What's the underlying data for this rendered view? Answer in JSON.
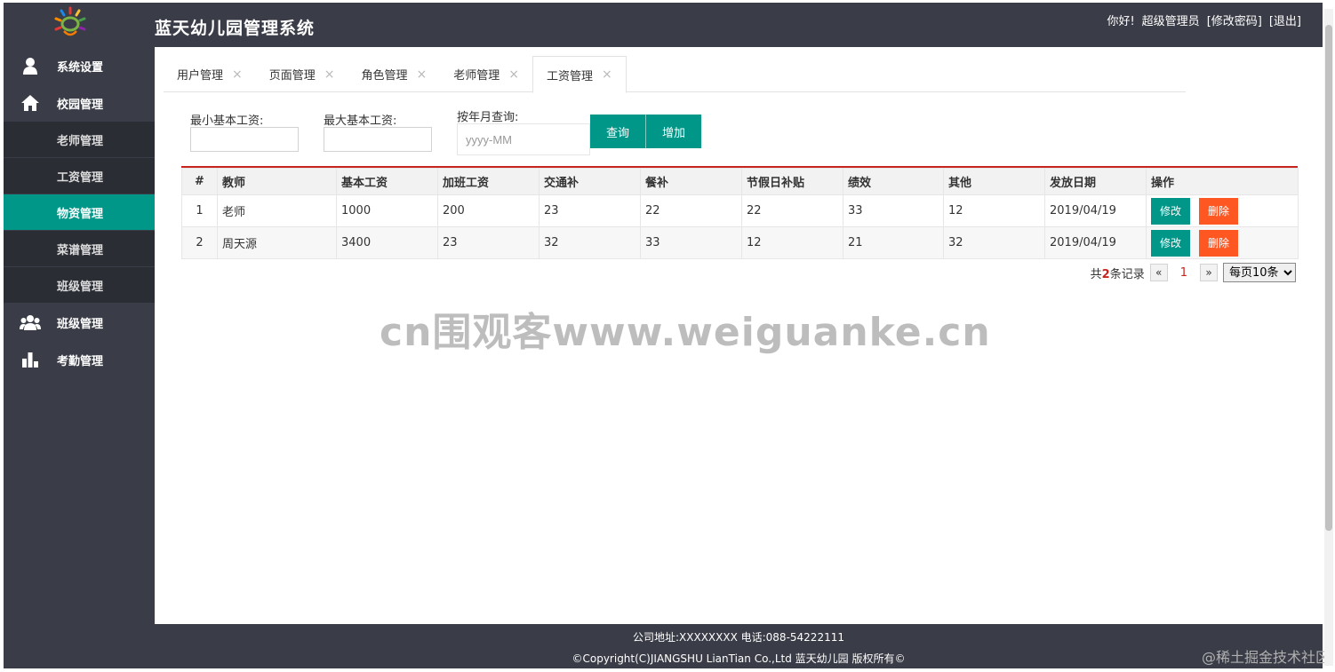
{
  "header": {
    "app_title": "蓝天幼儿园管理系统",
    "greeting": "你好!",
    "username": "超级管理员",
    "change_password": "[修改密码]",
    "logout": "[退出]"
  },
  "sidebar": {
    "items": [
      {
        "label": "系统设置",
        "icon": "user-icon"
      },
      {
        "label": "校园管理",
        "icon": "home-icon"
      },
      {
        "label": "班级管理",
        "icon": "group-icon"
      },
      {
        "label": "考勤管理",
        "icon": "bar-chart-icon"
      }
    ],
    "sub_items": [
      {
        "label": "老师管理"
      },
      {
        "label": "工资管理"
      },
      {
        "label": "物资管理"
      },
      {
        "label": "菜谱管理"
      },
      {
        "label": "班级管理"
      }
    ],
    "active_sub": "物资管理"
  },
  "tabs": [
    {
      "label": "用户管理",
      "close": "×"
    },
    {
      "label": "页面管理",
      "close": "×"
    },
    {
      "label": "角色管理",
      "close": "×"
    },
    {
      "label": "老师管理",
      "close": "×"
    },
    {
      "label": "工资管理",
      "close": "×"
    }
  ],
  "filters": {
    "min_salary_label": "最小基本工资:",
    "min_salary_value": "",
    "max_salary_label": "最大基本工资:",
    "max_salary_value": "",
    "month_label": "按年月查询:",
    "month_placeholder": "yyyy-MM",
    "query_button": "查询",
    "add_button": "增加"
  },
  "table": {
    "headers": [
      "#",
      "教师",
      "基本工资",
      "加班工资",
      "交通补",
      "餐补",
      "节假日补贴",
      "绩效",
      "其他",
      "发放日期",
      "操作"
    ],
    "rows": [
      {
        "no": "1",
        "teacher": "老师",
        "base": "1000",
        "overtime": "200",
        "traffic": "23",
        "meal": "22",
        "holiday": "22",
        "performance": "33",
        "other": "12",
        "date": "2019/04/19"
      },
      {
        "no": "2",
        "teacher": "周天源",
        "base": "3400",
        "overtime": "23",
        "traffic": "32",
        "meal": "33",
        "holiday": "12",
        "performance": "21",
        "other": "32",
        "date": "2019/04/19"
      }
    ],
    "edit_label": "修改",
    "delete_label": "删除"
  },
  "pager": {
    "prefix": "共",
    "total": "2",
    "suffix": "条记录",
    "prev": "«",
    "current": "1",
    "next": "»",
    "page_size": "每页10条"
  },
  "watermark": "cn围观客www.weiguanke.cn",
  "footer": {
    "line1": "公司地址:XXXXXXXX 电话:088-54222111",
    "line2": "©Copyright(C)JIANGSHU LianTian Co.,Ltd 蓝天幼儿园 版权所有©"
  },
  "corner_mark": "@稀土掘金技术社区",
  "colors": {
    "primary": "#009688",
    "danger": "#ff5722",
    "dark": "#3a3d47",
    "accent_red": "#c9231d"
  }
}
